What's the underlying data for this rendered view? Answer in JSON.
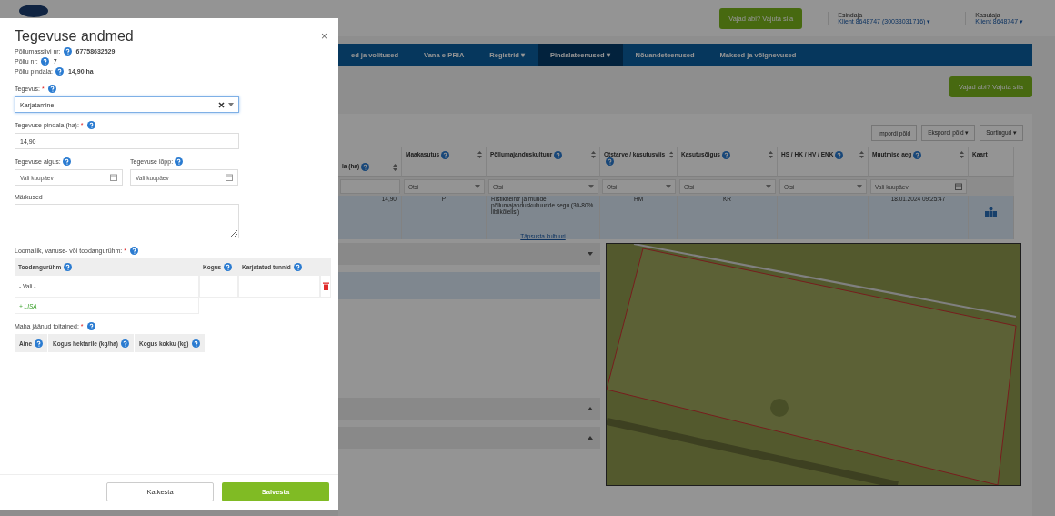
{
  "header": {
    "help_button": "Vajad abi? Vajuta siia",
    "representative": {
      "label": "Esindaja",
      "value": "Klient 8648747 (30033031716) ▾"
    },
    "user": {
      "label": "Kasutaja",
      "value": "Klient 8648747 ▾"
    }
  },
  "nav": [
    {
      "label": "ed ja volitused",
      "selected": false
    },
    {
      "label": "Vana e-PRIA",
      "selected": false
    },
    {
      "label": "Registrid ▾",
      "selected": false
    },
    {
      "label": "Pindalateenused ▾",
      "selected": true
    },
    {
      "label": "Nõuandeteenused",
      "selected": false
    },
    {
      "label": "Maksed ja võlgnevused",
      "selected": false
    }
  ],
  "help_button_2": "Vajad abi? Vajuta siia",
  "toolbar": [
    "Impordi põld",
    "Ekspordi põld ▾",
    "Sortingud ▾"
  ],
  "table": {
    "columns": [
      {
        "label": "la (ha)",
        "kind": "help"
      },
      {
        "label": "Maakasutus",
        "kind": "help"
      },
      {
        "label": "Põllumajanduskultuur",
        "kind": "help"
      },
      {
        "label": "Otstarve / kasutusviis",
        "kind": "help"
      },
      {
        "label": "Kasutusõigus",
        "kind": "help"
      },
      {
        "label": "HS / HK / HV / ENK",
        "kind": "help"
      },
      {
        "label": "Muutmise aeg",
        "kind": "help"
      },
      {
        "label": "Kaart",
        "kind": "plain"
      }
    ],
    "filters": [
      {
        "kind": "text"
      },
      {
        "kind": "select",
        "placeholder": "Otsi"
      },
      {
        "kind": "select",
        "placeholder": "Otsi"
      },
      {
        "kind": "select",
        "placeholder": "Otsi"
      },
      {
        "kind": "select",
        "placeholder": "Otsi"
      },
      {
        "kind": "select",
        "placeholder": "Otsi"
      },
      {
        "kind": "date",
        "placeholder": "Vali kuupäev"
      },
      {
        "kind": "none"
      }
    ],
    "rows": [
      {
        "selected": true,
        "cells": [
          "14,90",
          "P",
          "Ristikheintr ja muude põllumajanduskultuuride segu (30-80% liblikõielisi)",
          "HM",
          "KR",
          "",
          "18.01.2024 09:25:47",
          ""
        ],
        "link": "Täpsusta kultuuri"
      }
    ]
  },
  "panels": [
    {
      "kind": "bar",
      "expanded": false
    },
    {
      "kind": "info"
    },
    {
      "kind": "bar",
      "expanded": true
    },
    {
      "kind": "bar",
      "expanded": true
    }
  ],
  "modal": {
    "title": "Tegevuse andmed",
    "close": "×",
    "info": [
      {
        "label": "Põllumassiivi nr:",
        "value": "67758632529"
      },
      {
        "label": "Põllu nr:",
        "value": "7"
      },
      {
        "label": "Põllu pindala:",
        "value": "14,90 ha"
      }
    ],
    "activity": {
      "label": "Tegevus:",
      "mark": "*",
      "value": "Karjatamine"
    },
    "area": {
      "label": "Tegevuse pindala (ha):",
      "mark": "*",
      "value": "14,90"
    },
    "start": {
      "label": "Tegevuse algus:",
      "placeholder": "Vali kuupäev"
    },
    "end": {
      "label": "Tegevuse lõpp:",
      "placeholder": "Vali kuupäev"
    },
    "notes": {
      "label": "Märkused"
    },
    "animals": {
      "label": "Loomaliik, vanuse- või toodangurühm:",
      "mark": "*",
      "columns": [
        "Toodangurühm",
        "Kogus",
        "Karjatatud tunnid"
      ],
      "rows": [
        {
          "group": "- Vali -"
        }
      ],
      "add": "+ LISA"
    },
    "nutrients": {
      "label": "Maha jäänud toitained:",
      "mark": "*",
      "columns": [
        "Aine",
        "Kogus hektarile (kg/ha)",
        "Kogus kokku (kg)"
      ]
    },
    "buttons": [
      {
        "label": "Katkesta",
        "kind": "secondary"
      },
      {
        "label": "Salvesta",
        "kind": "primary"
      }
    ]
  }
}
